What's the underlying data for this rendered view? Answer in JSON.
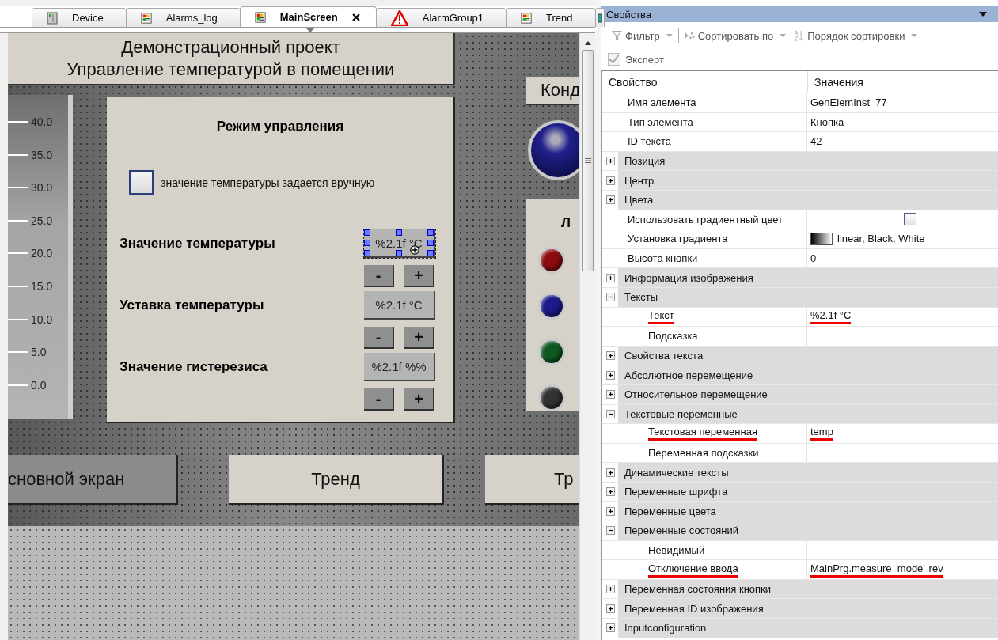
{
  "editor": {
    "tabs": [
      {
        "label": "Device",
        "kind": "device",
        "selected": false
      },
      {
        "label": "Alarms_log",
        "kind": "screen",
        "selected": false
      },
      {
        "label": "MainScreen",
        "kind": "screen",
        "selected": true
      },
      {
        "label": "AlarmGroup1",
        "kind": "alarm",
        "selected": false
      },
      {
        "label": "Trend",
        "kind": "screen",
        "selected": false
      },
      {
        "kind": "partial",
        "selected": false
      }
    ],
    "screen": {
      "title_lines": [
        "Демонстрационный проект",
        "Управление температурой в помещении"
      ],
      "scale_ticks": [
        "40.0",
        "35.0",
        "30.0",
        "25.0",
        "20.0",
        "15.0",
        "10.0",
        "5.0",
        "0.0"
      ],
      "mode_panel": {
        "title": "Режим управления",
        "manual_checkbox": {
          "label": "значение температуры задается вручную",
          "checked": false
        },
        "fields": [
          {
            "label": "Значение температуры",
            "value": "%2.1f °C",
            "selected": true,
            "minus": "-",
            "plus": "+"
          },
          {
            "label": "Уставка температуры",
            "value": "%2.1f °C",
            "selected": false,
            "minus": "-",
            "plus": "+"
          },
          {
            "label": "Значение гистерезиса",
            "value": "%2.1f %%",
            "selected": false,
            "minus": "-",
            "plus": "+"
          }
        ]
      },
      "side_button": "Конд",
      "side_panel_title": "Л",
      "lamps": [
        {
          "color": "#8e0c10"
        },
        {
          "color": "#1c1a8c"
        },
        {
          "color": "#0f5a22"
        },
        {
          "color": "#333333"
        }
      ],
      "nav_buttons": [
        {
          "label": "сновной экран",
          "selected": true
        },
        {
          "label": "Тренд",
          "selected": false
        },
        {
          "label": "Тр",
          "selected": false
        }
      ]
    }
  },
  "properties": {
    "title": "Свойства",
    "toolbar": [
      {
        "label": "Фильтр",
        "disabled": true
      },
      {
        "label": "Сортировать по",
        "disabled": true
      },
      {
        "label": "Порядок сортировки",
        "disabled": true
      }
    ],
    "expert": {
      "label": "Эксперт",
      "checked": true,
      "disabled": true
    },
    "columns": [
      "Свойство",
      "Значения"
    ],
    "rows": [
      {
        "kind": "prop",
        "name": "Имя элемента",
        "value": "GenElemInst_77"
      },
      {
        "kind": "prop",
        "name": "Тип элемента",
        "value": "Кнопка"
      },
      {
        "kind": "prop",
        "name": "ID текста",
        "value": "42"
      },
      {
        "kind": "group",
        "name": "Позиция",
        "expanded": false
      },
      {
        "kind": "group",
        "name": "Центр",
        "expanded": false
      },
      {
        "kind": "group",
        "name": "Цвета",
        "expanded": false
      },
      {
        "kind": "checkbox",
        "name": "Использовать градиентный цвет",
        "checked": false
      },
      {
        "kind": "gradient",
        "name": "Установка градиента",
        "value": "linear, Black, White"
      },
      {
        "kind": "prop",
        "name": "Высота кнопки",
        "value": "0"
      },
      {
        "kind": "group",
        "name": "Информация изображения",
        "expanded": false
      },
      {
        "kind": "group",
        "name": "Тексты",
        "expanded": true,
        "children": [
          {
            "kind": "prop",
            "name": "Текст",
            "value": "%2.1f °C",
            "marked": true
          },
          {
            "kind": "prop",
            "name": "Подсказка"
          }
        ]
      },
      {
        "kind": "group",
        "name": "Свойства текста",
        "expanded": false
      },
      {
        "kind": "group",
        "name": "Абсолютное перемещение",
        "expanded": false
      },
      {
        "kind": "group",
        "name": "Относительное перемещение",
        "expanded": false
      },
      {
        "kind": "group",
        "name": "Текстовые переменные",
        "expanded": true,
        "children": [
          {
            "kind": "prop",
            "name": "Текстовая переменная",
            "value": "temp",
            "marked": true
          },
          {
            "kind": "prop",
            "name": "Переменная подсказки"
          }
        ]
      },
      {
        "kind": "group",
        "name": "Динамические тексты",
        "expanded": false
      },
      {
        "kind": "group",
        "name": "Переменные шрифта",
        "expanded": false
      },
      {
        "kind": "group",
        "name": "Переменные цвета",
        "expanded": false
      },
      {
        "kind": "group",
        "name": "Переменные состояний",
        "expanded": true,
        "children": [
          {
            "kind": "prop",
            "name": "Невидимый"
          },
          {
            "kind": "prop",
            "name": "Отключение ввода",
            "value": "MainPrg.measure_mode_rev",
            "marked": true
          }
        ]
      },
      {
        "kind": "group",
        "name": "Переменная состояния кнопки",
        "expanded": false
      },
      {
        "kind": "group",
        "name": "Переменная ID изображения",
        "expanded": false
      },
      {
        "kind": "group",
        "name": "Inputconfiguration",
        "expanded": false
      }
    ]
  }
}
